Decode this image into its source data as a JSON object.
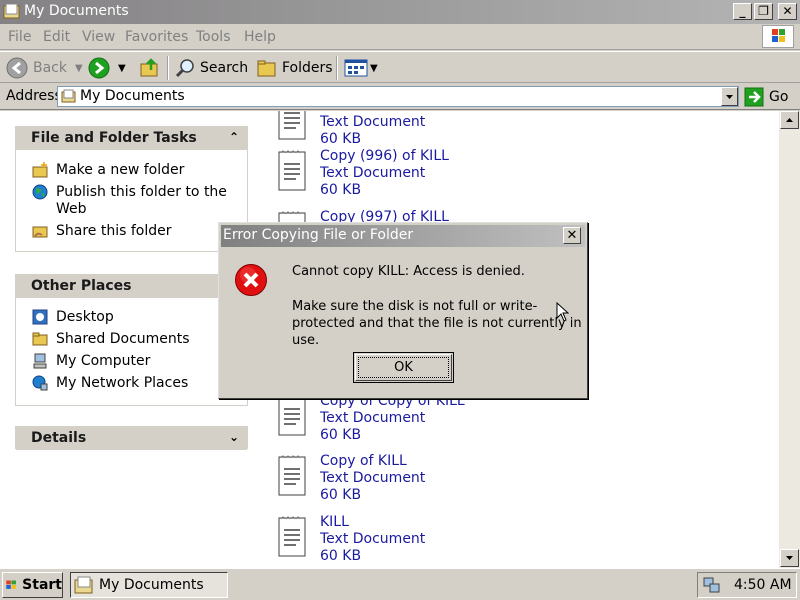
{
  "window": {
    "title": "My Documents",
    "buttons": [
      "minimize",
      "restore",
      "close"
    ]
  },
  "menubar": {
    "items": [
      "File",
      "Edit",
      "View",
      "Favorites",
      "Tools",
      "Help"
    ]
  },
  "toolbar": {
    "back_label": "Back",
    "search_label": "Search",
    "folders_label": "Folders"
  },
  "address": {
    "label": "Address",
    "value": "My Documents",
    "go_label": "Go"
  },
  "tasks_panel": {
    "title": "File and Folder Tasks",
    "items": [
      "Make a new folder",
      "Publish this folder to the Web",
      "Share this folder"
    ]
  },
  "places_panel": {
    "title": "Other Places",
    "items": [
      "Desktop",
      "Shared Documents",
      "My Computer",
      "My Network Places"
    ]
  },
  "details_panel": {
    "title": "Details"
  },
  "files": [
    {
      "name": "",
      "type": "Text Document",
      "size": "60 KB"
    },
    {
      "name": "Copy (996) of KILL",
      "type": "Text Document",
      "size": "60 KB"
    },
    {
      "name": "Copy (997) of KILL",
      "type": "",
      "size": ""
    },
    {
      "name": "Copy of Copy of KILL",
      "type": "Text Document",
      "size": "60 KB"
    },
    {
      "name": "Copy of KILL",
      "type": "Text Document",
      "size": "60 KB"
    },
    {
      "name": "KILL",
      "type": "Text Document",
      "size": "60 KB"
    }
  ],
  "dialog": {
    "title": "Error Copying File or Folder",
    "message": "Cannot copy KILL: Access is denied.",
    "detail": "Make sure the disk is not full or write-protected and that the file is not currently in use.",
    "ok_label": "OK",
    "close_label": "✕",
    "icon": "error-icon"
  },
  "taskbar": {
    "start_label": "Start",
    "task_label": "My Documents",
    "clock": "4:50 AM"
  }
}
